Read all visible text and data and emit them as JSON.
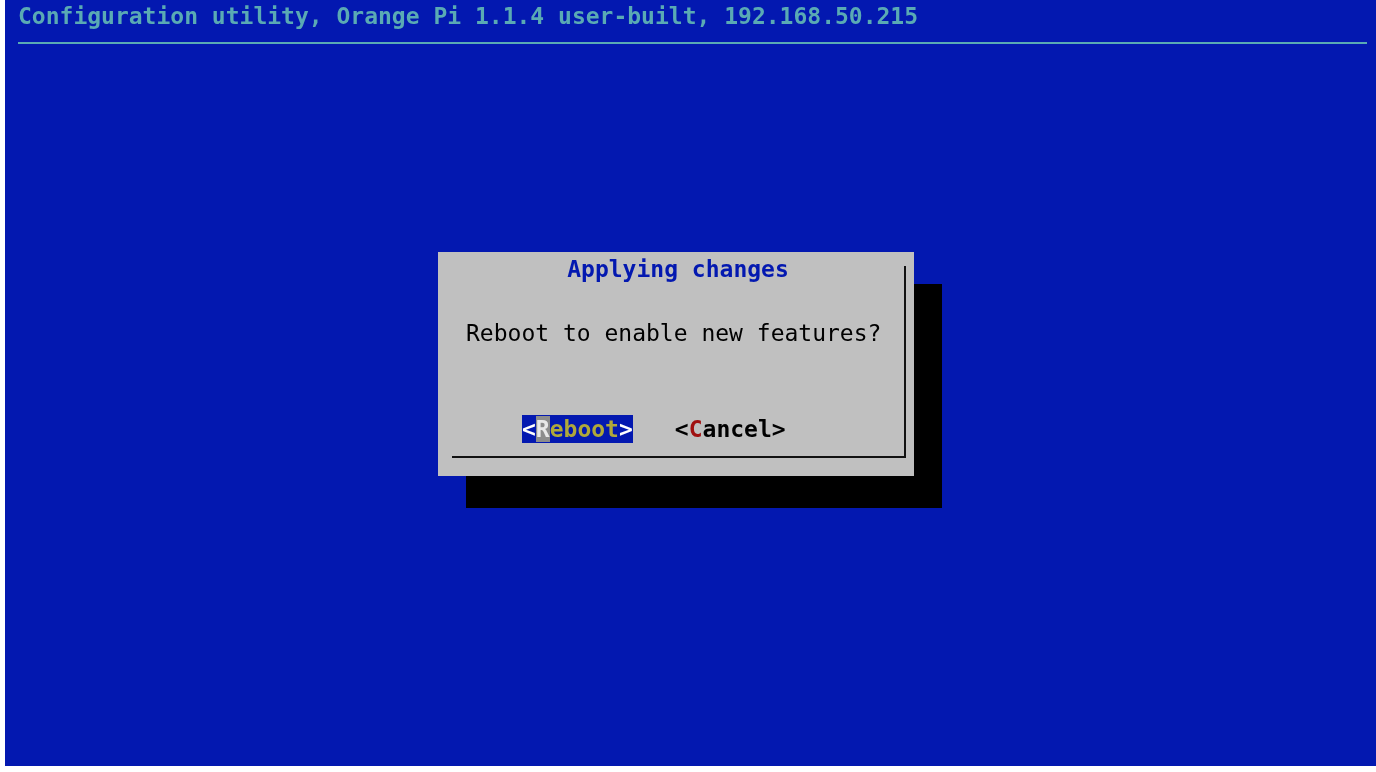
{
  "header": {
    "title": "Configuration utility, Orange Pi 1.1.4 user-built, 192.168.50.215"
  },
  "dialog": {
    "title": "Applying changes",
    "message": "Reboot to enable new features?",
    "buttons": [
      {
        "open": "<",
        "hotkey": "R",
        "rest": "eboot",
        "close": ">",
        "selected": true
      },
      {
        "open": "<",
        "hotkey": "C",
        "rest": "ancel",
        "close": ">",
        "selected": false
      }
    ]
  }
}
